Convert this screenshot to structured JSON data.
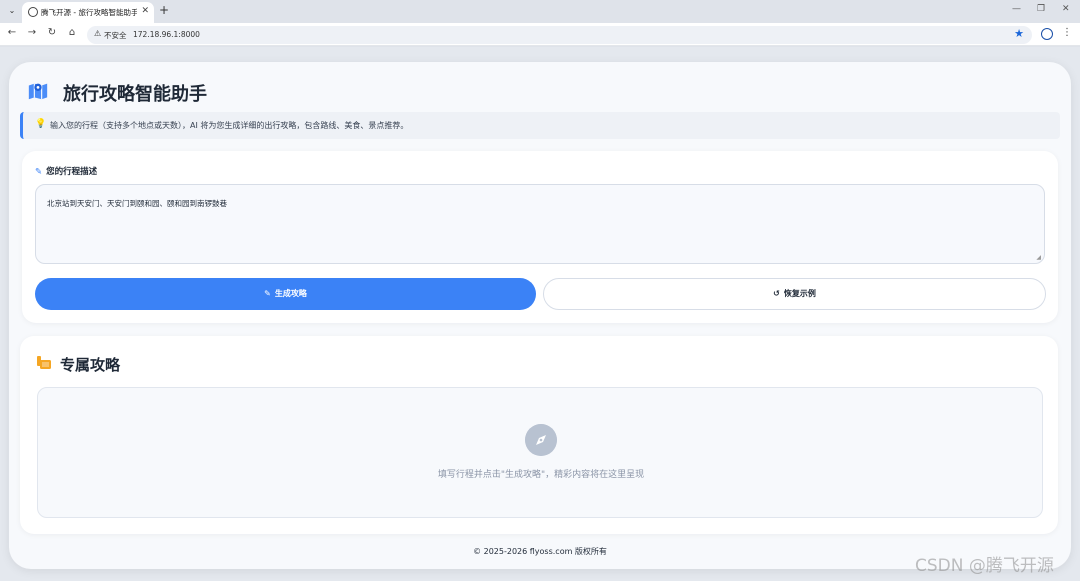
{
  "browser": {
    "tab_title": "腾飞开源 - 旅行攻略智能助手",
    "security_label": "不安全",
    "url": "172.18.96.1:8000"
  },
  "app": {
    "title": "旅行攻略智能助手",
    "hint": "输入您的行程（支持多个地点或天数），AI 将为您生成详细的出行攻略，包含路线、美食、景点推荐。"
  },
  "input_card": {
    "label": "您的行程描述",
    "value": "北京站到天安门、天安门到颐和园、颐和园到南锣鼓巷",
    "generate_label": "生成攻略",
    "reset_label": "恢复示例"
  },
  "result_card": {
    "title": "专属攻略",
    "placeholder": "填写行程并点击\"生成攻略\"，精彩内容将在这里呈现"
  },
  "footer": {
    "text": "© 2025-2026 flyoss.com 版权所有"
  },
  "watermark": "CSDN @腾飞开源",
  "colors": {
    "accent": "#3b82f6",
    "page_bg": "#f7f9fc",
    "result_icon": "#f5a623"
  }
}
